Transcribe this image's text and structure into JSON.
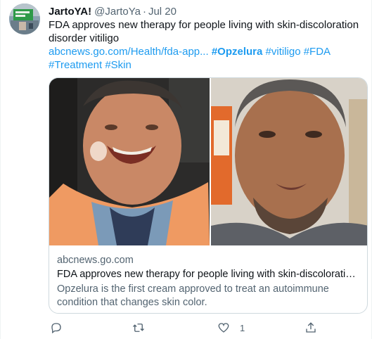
{
  "tweet": {
    "display_name": "JartoYA!",
    "handle": "@JartoYa",
    "separator": "·",
    "date": "Jul 20",
    "text": "FDA approves new therapy for people living with skin-discoloration disorder vitiligo",
    "link_text": "abcnews.go.com/Health/fda-app...",
    "hashtags": [
      "#Opzelura",
      "#vitiligo",
      "#FDA",
      "#Treatment",
      "#Skin"
    ]
  },
  "card": {
    "domain": "abcnews.go.com",
    "title": "FDA approves new therapy for people living with skin-discoloration dis...",
    "description": "Opzelura is the first cream approved to treat an autoimmune condition that changes skin color."
  },
  "actions": {
    "reply_icon": "reply-icon",
    "retweet_icon": "retweet-icon",
    "like_icon": "heart-icon",
    "like_count": "1",
    "share_icon": "share-icon"
  },
  "colors": {
    "link": "#1d9bf0",
    "secondary_text": "#536471",
    "primary_text": "#0f1419",
    "border": "#cfd9de"
  }
}
